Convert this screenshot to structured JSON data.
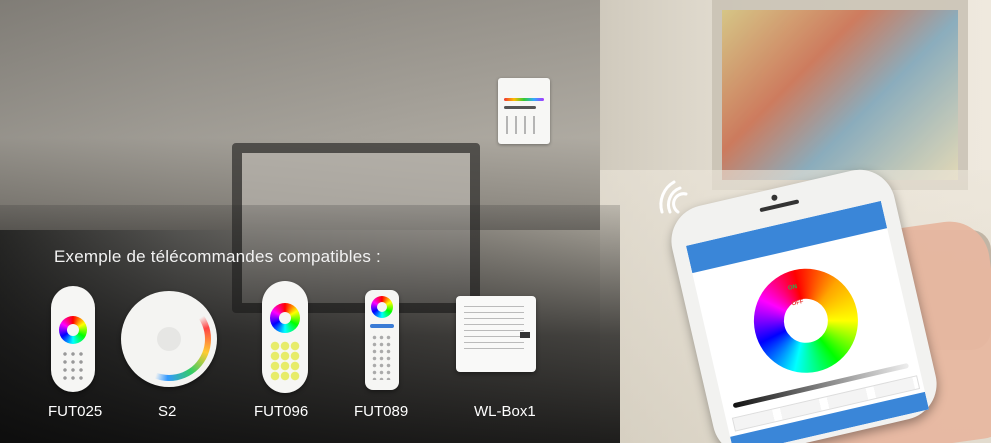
{
  "caption": "Exemple de télécommandes compatibles :",
  "products": [
    {
      "label": "FUT025"
    },
    {
      "label": "S2"
    },
    {
      "label": "FUT096"
    },
    {
      "label": "FUT089"
    },
    {
      "label": "WL-Box1"
    }
  ],
  "app_screen": {
    "on_label": "ON",
    "off_label": "OFF"
  }
}
